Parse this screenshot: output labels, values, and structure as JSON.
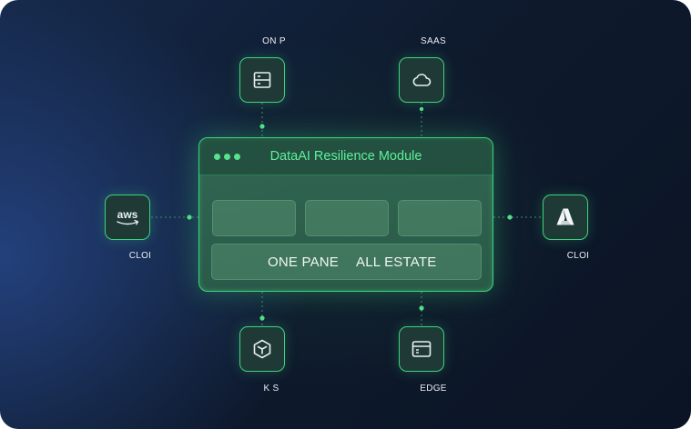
{
  "module": {
    "title": "DataAI Resilience Module",
    "bar_left": "ONE PANE",
    "bar_right": "ALL ESTATE"
  },
  "nodes": {
    "on_prem": {
      "label": "ON  P",
      "icon": "server-icon"
    },
    "saas": {
      "label": "SAAS",
      "icon": "cloud-icon"
    },
    "aws": {
      "label": "CLOI",
      "icon": "aws-logo-icon",
      "logo_text": "aws"
    },
    "azure": {
      "label": "CLOI",
      "icon": "azure-logo-icon"
    },
    "k8s": {
      "label": "K  S",
      "icon": "cube-icon"
    },
    "edge": {
      "label": "EDGE",
      "icon": "browser-window-icon"
    }
  },
  "colors": {
    "accent": "#3ed27d",
    "title_green": "#5ef09a",
    "background": "#0e1a2d"
  }
}
